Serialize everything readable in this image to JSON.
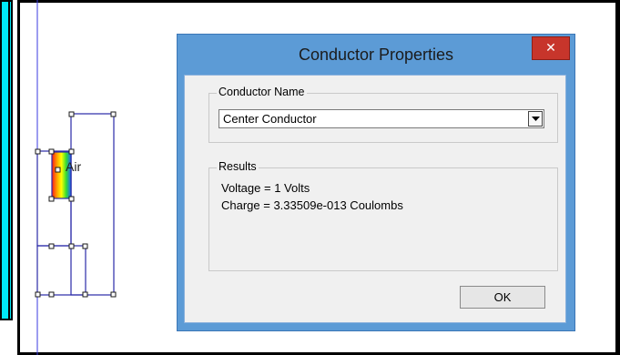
{
  "canvas": {
    "air_label": "Air"
  },
  "dialog": {
    "title": "Conductor Properties",
    "close_glyph": "✕",
    "conductor_name_group": {
      "legend": "Conductor Name",
      "selected_value": "Center Conductor"
    },
    "results_group": {
      "legend": "Results",
      "lines": [
        "Voltage = 1 Volts",
        "Charge = 3.33509e-013 Coulombs"
      ]
    },
    "ok_label": "OK"
  },
  "icons": {
    "close": "close-icon",
    "dropdown": "chevron-down-icon"
  },
  "colors": {
    "dialog_frame": "#5c9bd6",
    "close_button": "#c7352b",
    "left_panel": "#00e8f8",
    "geometry_lines": "#2a2aa8"
  }
}
